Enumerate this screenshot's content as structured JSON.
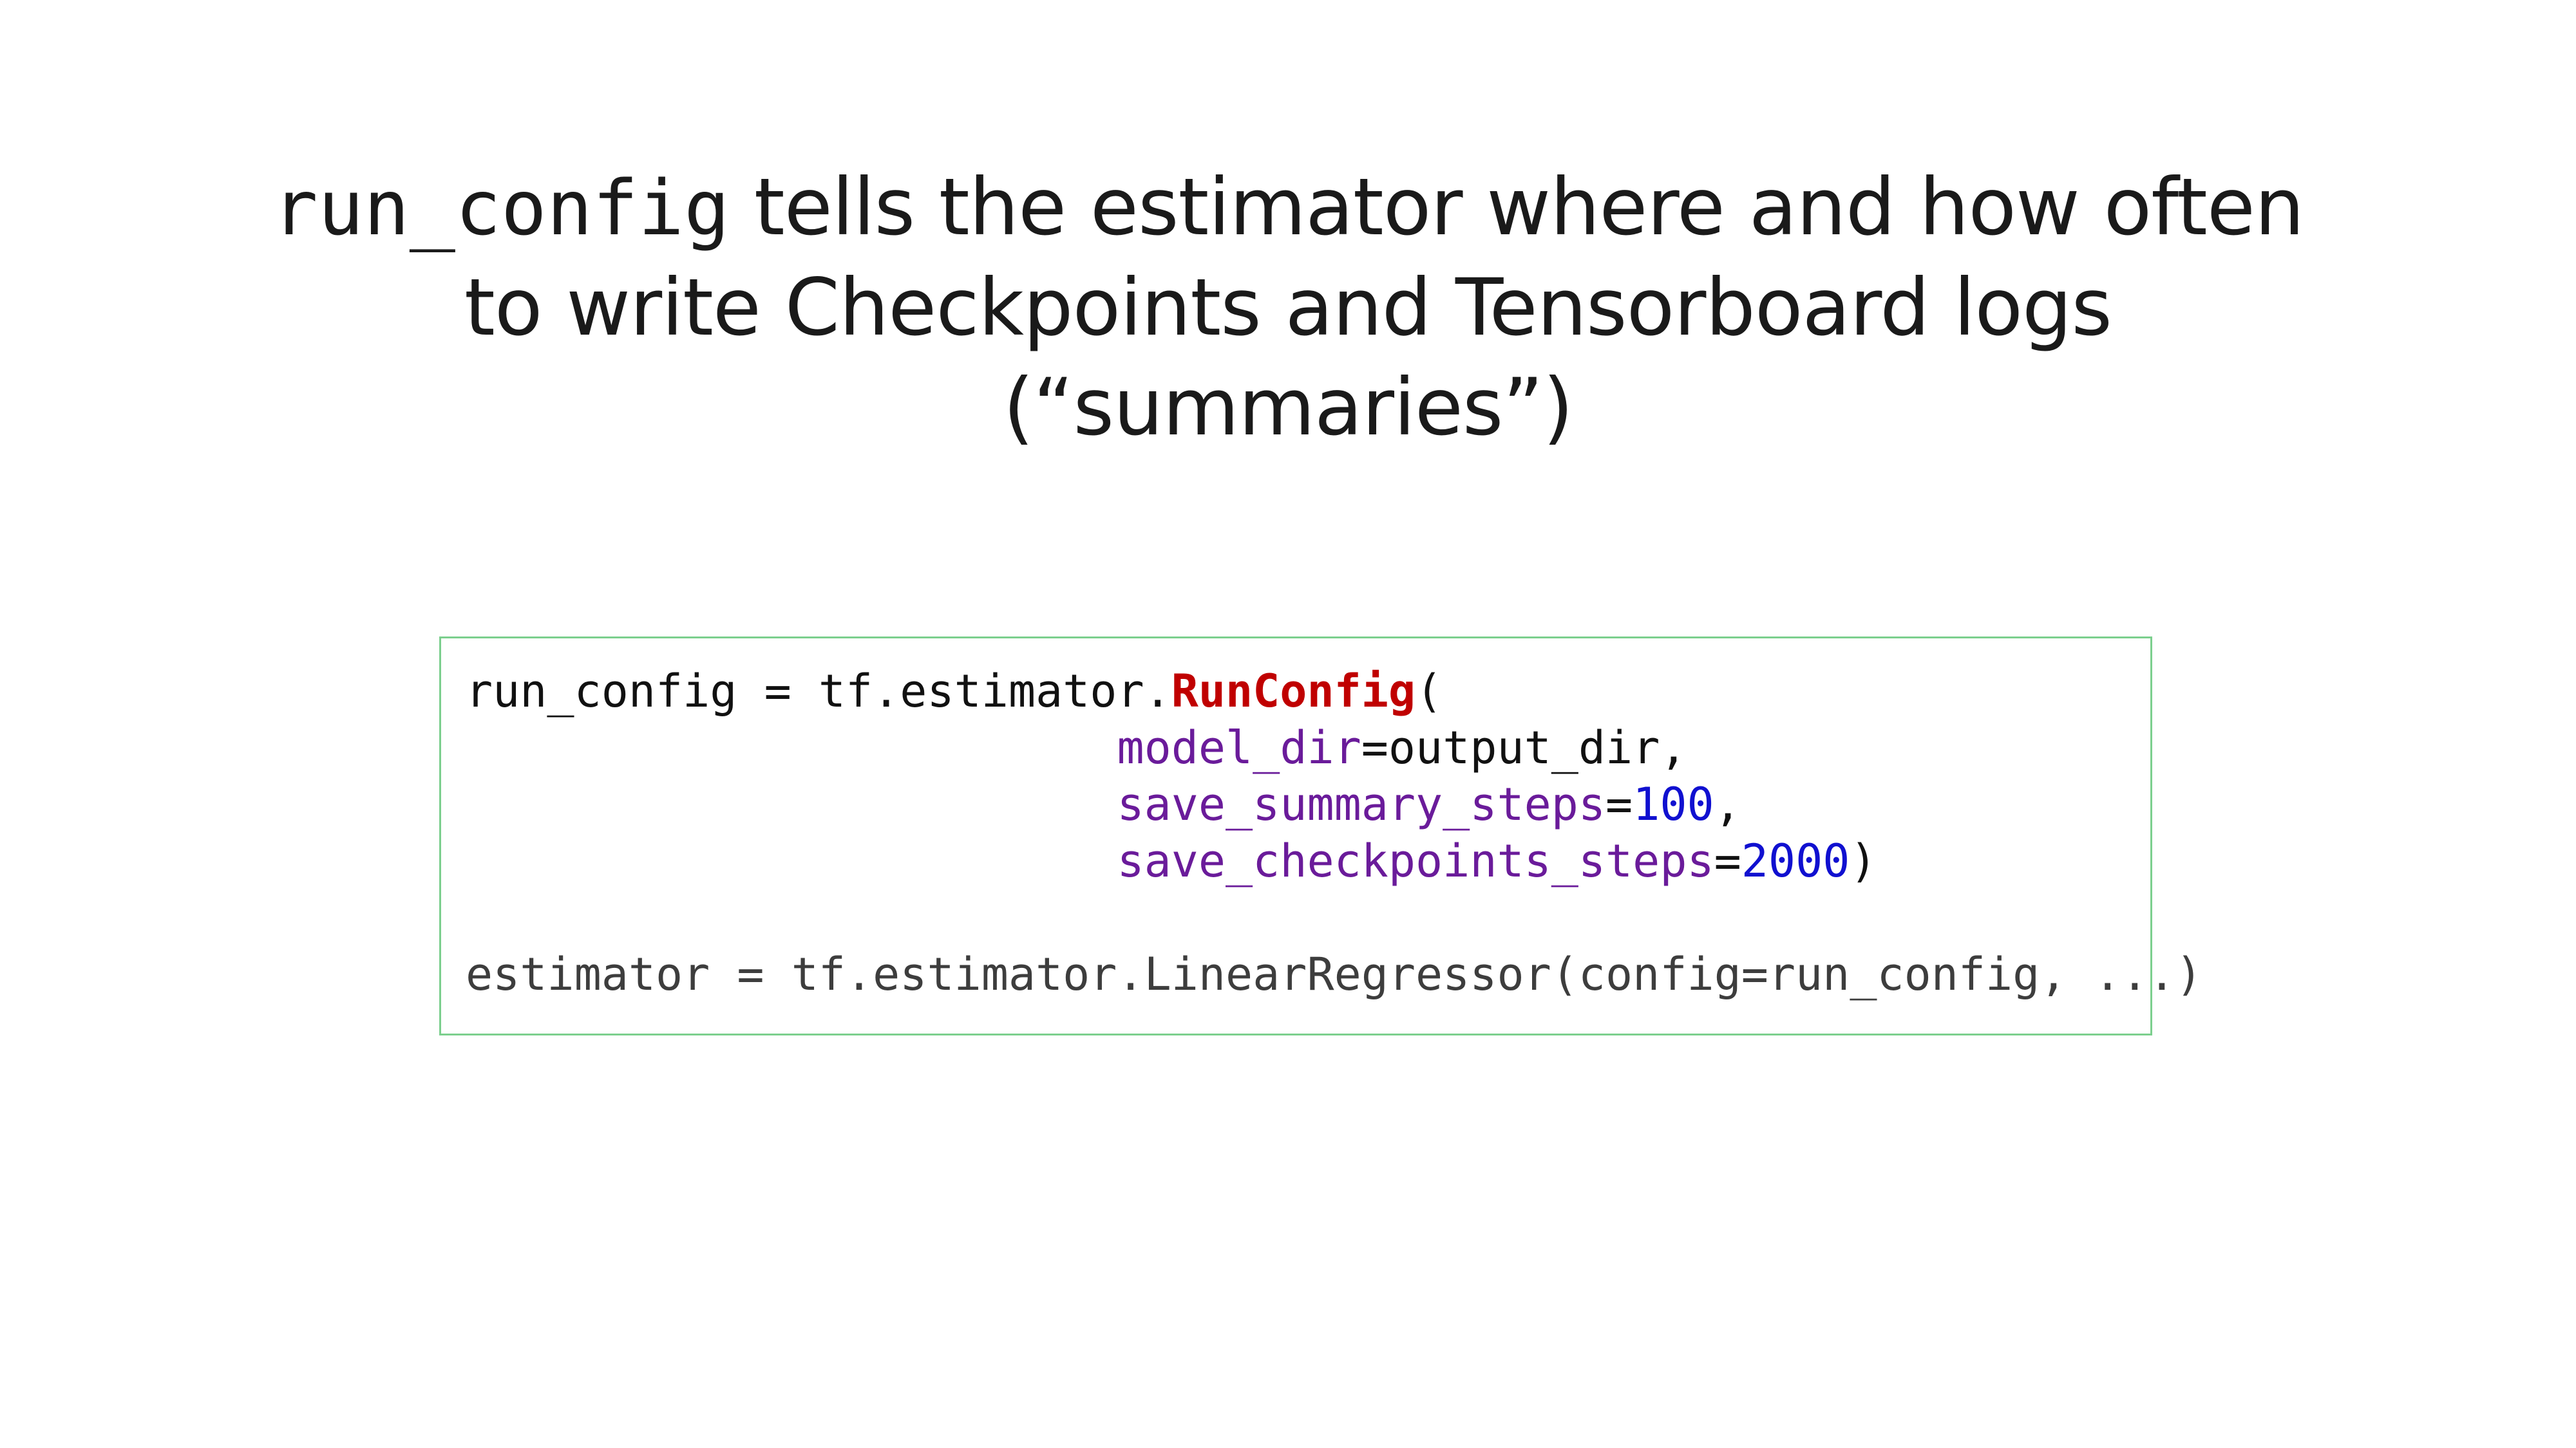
{
  "title": {
    "code_term": "run_config",
    "line1_rest": " tells the estimator where and how often",
    "line2": "to write Checkpoints and Tensorboard logs",
    "line3": "(“summaries”)"
  },
  "code": {
    "line1": {
      "prefix": "run_config = tf.estimator.",
      "func": "RunConfig",
      "suffix": "("
    },
    "line2": {
      "indent": "                        ",
      "param": "model_dir",
      "eq": "=",
      "value": "output_dir",
      "suffix": ","
    },
    "line3": {
      "indent": "                        ",
      "param": "save_summary_steps",
      "eq": "=",
      "value": "100",
      "suffix": ","
    },
    "line4": {
      "indent": "                        ",
      "param": "save_checkpoints_steps",
      "eq": "=",
      "value": "2000",
      "suffix": ")"
    },
    "line6": "estimator = tf.estimator.LinearRegressor(config=run_config, ...)"
  },
  "colors": {
    "function_name": "#c00000",
    "parameter": "#6a1b9a",
    "number": "#1010d0",
    "box_border": "#7ccf8e"
  }
}
